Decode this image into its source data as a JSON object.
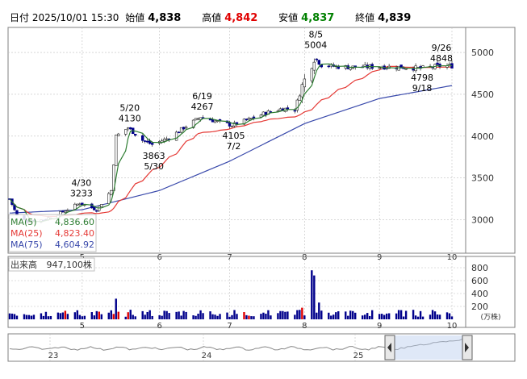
{
  "header": {
    "datetime": "日付 2025/10/01 15:30",
    "open_label": "始値",
    "open_value": "4,838",
    "high_label": "高値",
    "high_value": "4,842",
    "low_label": "安値",
    "low_value": "4,837",
    "close_label": "終値",
    "close_value": "4,839"
  },
  "legend": [
    {
      "label": "MA(5)",
      "value": "4,836.60",
      "color": "#2e7d32"
    },
    {
      "label": "MA(25)",
      "value": "4,823.40",
      "color": "#e53935"
    },
    {
      "label": "MA(75)",
      "value": "4,604.92",
      "color": "#3949ab"
    }
  ],
  "volume_legend": {
    "label": "出来高",
    "value": "947,100株"
  },
  "volume_unit": "(万株)",
  "colors": {
    "up": "#e00000",
    "down": "#00008b",
    "ma5": "#2e7d32",
    "ma25": "#e53935",
    "ma75": "#3949ab",
    "grid": "#c0c0c0",
    "volume": "#00008b"
  },
  "chart_data": {
    "type": "candlestick",
    "x_ticks": [
      "5",
      "6",
      "7",
      "8",
      "9",
      "10"
    ],
    "x_tick_dates": [
      "2025-05-01",
      "2025-06-02",
      "2025-07-01",
      "2025-08-01",
      "2025-09-01",
      "2025-10-01"
    ],
    "y_ticks": [
      3000,
      3500,
      4000,
      4500,
      5000
    ],
    "ylim": [
      2600,
      5300
    ],
    "annotations": [
      {
        "date": "2025-04-30",
        "value": 3233,
        "label_top": "4/30",
        "label_bottom": "3233",
        "kind": "high"
      },
      {
        "date": "2025-05-20",
        "value": 4130,
        "label_top": "5/20",
        "label_bottom": "4130",
        "kind": "high"
      },
      {
        "date": "2025-05-30",
        "value": 3863,
        "label_top": "3863",
        "label_bottom": "5/30",
        "kind": "low"
      },
      {
        "date": "2025-06-19",
        "value": 4267,
        "label_top": "6/19",
        "label_bottom": "4267",
        "kind": "high"
      },
      {
        "date": "2025-07-02",
        "value": 4105,
        "label_top": "4105",
        "label_bottom": "7/2",
        "kind": "low"
      },
      {
        "date": "2025-08-05",
        "value": 5004,
        "label_top": "8/5",
        "label_bottom": "5004",
        "kind": "high"
      },
      {
        "date": "2025-09-18",
        "value": 4798,
        "label_top": "4798",
        "label_bottom": "9/18",
        "kind": "low"
      },
      {
        "date": "2025-09-26",
        "value": 4848,
        "label_top": "9/26",
        "label_bottom": "4848",
        "kind": "high"
      }
    ],
    "price_path": [
      [
        "2025-04-01",
        3250
      ],
      [
        "2025-04-04",
        3050
      ],
      [
        "2025-04-08",
        2980
      ],
      [
        "2025-04-15",
        3000
      ],
      [
        "2025-04-22",
        3080
      ],
      [
        "2025-04-30",
        3200
      ],
      [
        "2025-05-07",
        3120
      ],
      [
        "2025-05-13",
        3350
      ],
      [
        "2025-05-15",
        4000
      ],
      [
        "2025-05-20",
        4100
      ],
      [
        "2025-05-26",
        3950
      ],
      [
        "2025-05-30",
        3900
      ],
      [
        "2025-06-06",
        3980
      ],
      [
        "2025-06-12",
        4100
      ],
      [
        "2025-06-19",
        4230
      ],
      [
        "2025-06-25",
        4180
      ],
      [
        "2025-07-02",
        4130
      ],
      [
        "2025-07-09",
        4200
      ],
      [
        "2025-07-16",
        4280
      ],
      [
        "2025-07-23",
        4330
      ],
      [
        "2025-07-28",
        4320
      ],
      [
        "2025-07-31",
        4600
      ],
      [
        "2025-08-05",
        4950
      ],
      [
        "2025-08-08",
        4850
      ],
      [
        "2025-08-15",
        4830
      ],
      [
        "2025-08-22",
        4825
      ],
      [
        "2025-09-01",
        4830
      ],
      [
        "2025-09-10",
        4825
      ],
      [
        "2025-09-18",
        4810
      ],
      [
        "2025-09-26",
        4840
      ],
      [
        "2025-10-01",
        4839
      ]
    ],
    "ma75_path": [
      [
        "2025-04-01",
        3080
      ],
      [
        "2025-05-01",
        3120
      ],
      [
        "2025-06-02",
        3350
      ],
      [
        "2025-07-01",
        3700
      ],
      [
        "2025-08-01",
        4150
      ],
      [
        "2025-09-01",
        4450
      ],
      [
        "2025-10-01",
        4605
      ]
    ],
    "volume": {
      "y_ticks": [
        200,
        400,
        600,
        800
      ],
      "ylim": [
        0,
        900
      ],
      "spikes": [
        [
          "2025-05-15",
          320
        ],
        [
          "2025-07-31",
          180
        ],
        [
          "2025-08-04",
          760
        ],
        [
          "2025-08-05",
          680
        ],
        [
          "2025-08-07",
          260
        ]
      ],
      "base": 100
    },
    "overview_ticks": [
      "23",
      "24",
      "25"
    ]
  }
}
